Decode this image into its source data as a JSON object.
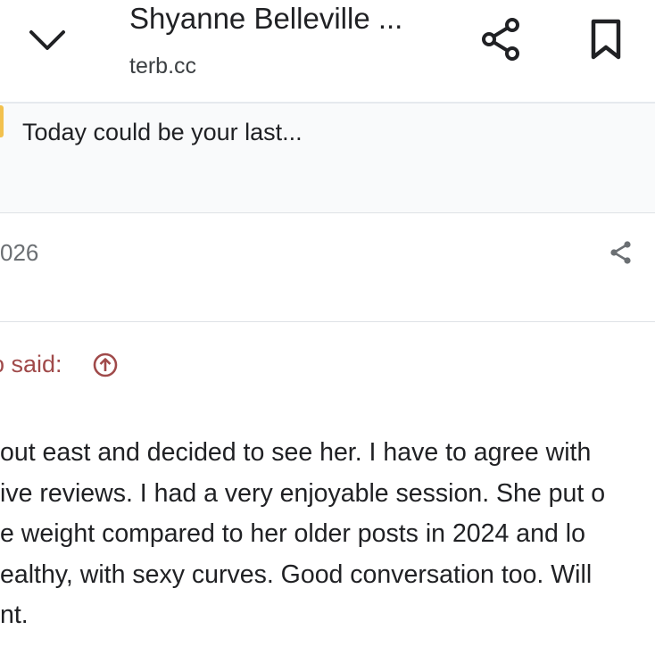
{
  "header": {
    "title": "Shyanne Belleville ...",
    "url": "terb.cc"
  },
  "notice": {
    "text": "Today could be your last..."
  },
  "post": {
    "date_fragment": "026",
    "quote_attribution": "o said:",
    "body_lines": [
      "out east and decided to see her. I have to agree with",
      "ive reviews. I had a very enjoyable session. She put o",
      "e weight compared to her older posts in 2024 and lo",
      "ealthy, with sexy curves. Good conversation too. Will",
      "nt."
    ]
  },
  "colors": {
    "quote_accent": "#a04a4a",
    "notice_marker": "#f2c14e",
    "muted_text": "#6b6f73"
  },
  "icons": {
    "back": "chevron-down-icon",
    "share": "share-icon",
    "bookmark": "bookmark-icon",
    "quote_jump": "arrow-up-circle-icon"
  }
}
